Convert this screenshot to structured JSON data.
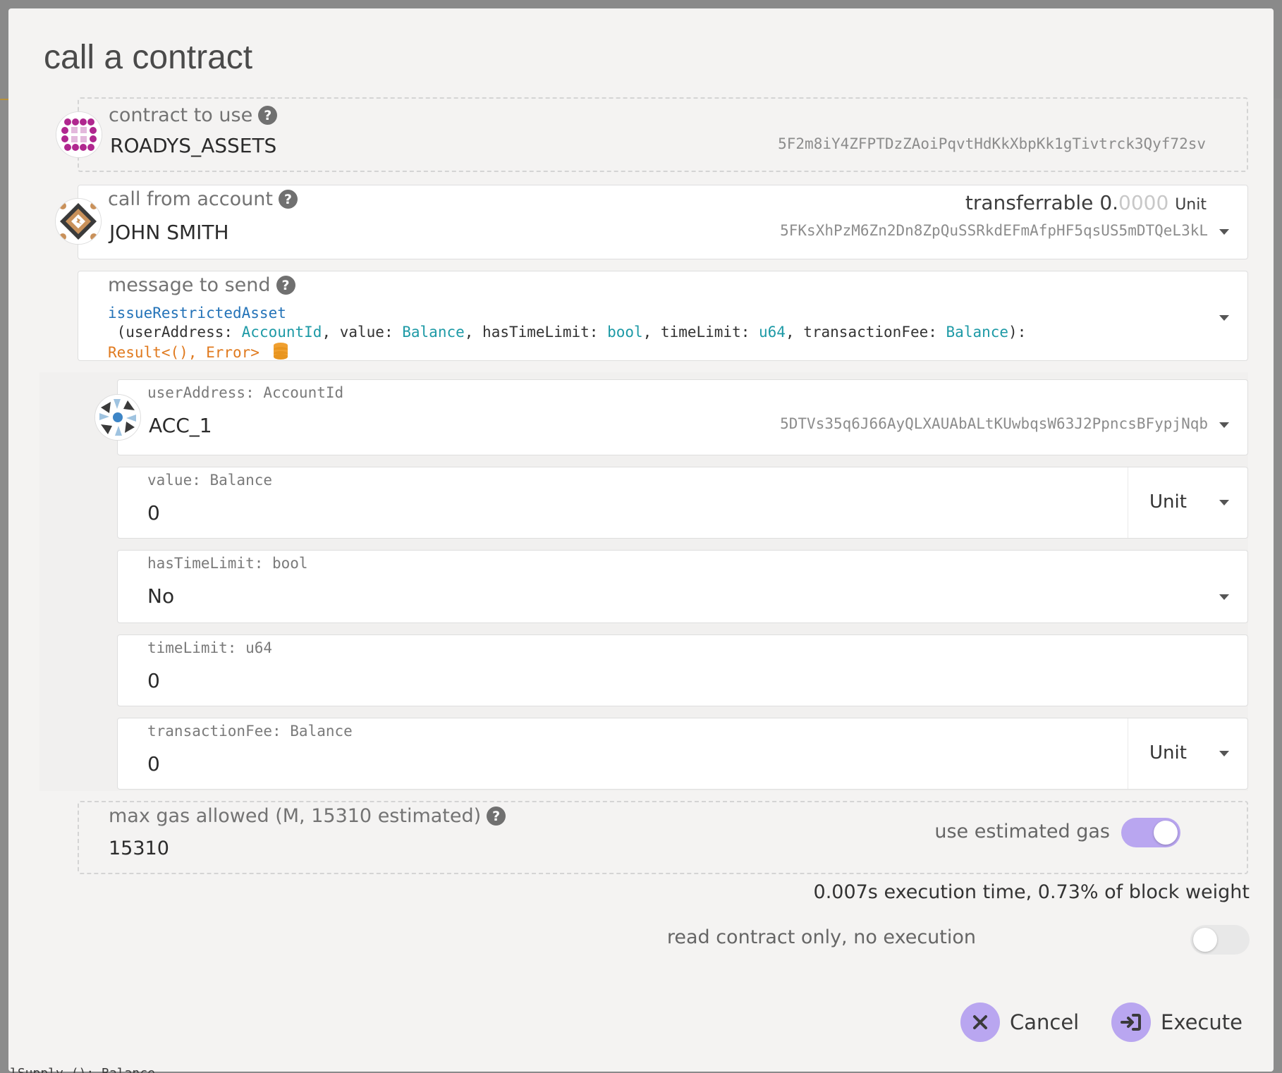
{
  "modal": {
    "title": "call a contract"
  },
  "contract": {
    "label": "contract to use",
    "name": "ROADYS_ASSETS",
    "address": "5F2m8iY4ZFPTDzZAoiPqvtHdKkXbpKk1gTivtrck3Qyf72sv"
  },
  "caller": {
    "label": "call from account",
    "name": "JOHN SMITH",
    "address": "5FKsXhPzM6Zn2Dn8ZpQuSSRkdEFmAfpHF5qsUS5mDTQeL3kL",
    "transferrable_label": "transferrable",
    "balance_int": "0.",
    "balance_dec": "0000",
    "balance_unit": "Unit"
  },
  "message": {
    "label": "message to send",
    "fn_name": "issueRestrictedAsset",
    "params_open": " (userAddress: ",
    "p1_type": "AccountId",
    "sep1": ", value: ",
    "p2_type": "Balance",
    "sep2": ", hasTimeLimit: ",
    "p3_type": "bool",
    "sep3": ", timeLimit: ",
    "p4_type": "u64",
    "sep4": ", transactionFee: ",
    "p5_type": "Balance",
    "params_close": "):",
    "return_type": "Result<(), Error>"
  },
  "params": {
    "user_address": {
      "label": "userAddress: AccountId",
      "name": "ACC_1",
      "address": "5DTVs35q6J66AyQLXAUAbALtKUwbqsW63J2PpncsBFypjNqb"
    },
    "value": {
      "label": "value: Balance",
      "value": "0",
      "unit": "Unit"
    },
    "has_time_limit": {
      "label": "hasTimeLimit: bool",
      "value": "No"
    },
    "time_limit": {
      "label": "timeLimit: u64",
      "value": "0"
    },
    "transaction_fee": {
      "label": "transactionFee: Balance",
      "value": "0",
      "unit": "Unit"
    }
  },
  "gas": {
    "label": "max gas allowed (M, 15310 estimated)",
    "value": "15310",
    "use_estimated_label": "use estimated gas",
    "use_estimated": true
  },
  "execution_info": "0.007s execution time, 0.73% of block weight",
  "read_only": {
    "label": "read contract only, no execution",
    "enabled": false
  },
  "buttons": {
    "cancel": "Cancel",
    "execute": "Execute"
  },
  "colors": {
    "accent": "#b9a6f0",
    "toggle_on": "#b9a6f0",
    "toggle_off": "#e8e8e8"
  },
  "background_peek": {
    "bottom_text": "lSupply (): Balance"
  }
}
